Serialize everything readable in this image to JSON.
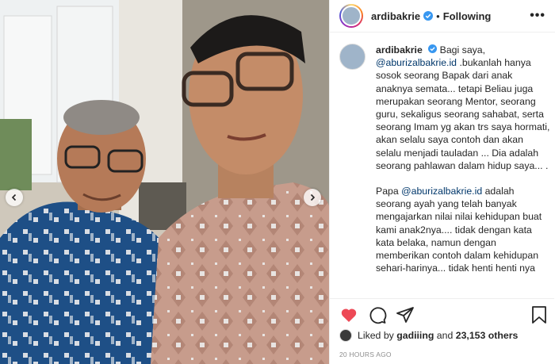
{
  "post": {
    "username": "ardibakrie",
    "follow_state": "Following",
    "separator": "•",
    "more_label": "•••"
  },
  "caption": {
    "username": "ardibakrie",
    "intro": "Bagi saya,",
    "mention1": "@aburizalbakrie.id",
    "text1": ".bukanlah hanya sosok seorang Bapak dari anak anaknya semata... tetapi Beliau juga merupakan seorang Mentor, seorang guru, sekaligus seorang sahabat, serta seorang Imam yg akan trs saya hormati, akan selalu saya contoh dan akan selalu menjadi tauladan ... Dia adalah seorang pahlawan dalam hidup saya... .",
    "papa": "Papa",
    "mention2": "@aburizalbakrie.id",
    "text2": "adalah seorang ayah yang telah banyak mengajarkan nilai nilai kehidupan buat kami anak2nya.... tidak dengan kata kata belaka, namun dengan memberikan contoh dalam kehidupan sehari-harinya... tidak henti henti nya"
  },
  "likes": {
    "liked_by": "Liked by",
    "user": "gadiiing",
    "and": "and",
    "count": "23,153 others"
  },
  "timestamp": "20 HOURS AGO",
  "icons": {
    "verified": "verified-badge-icon",
    "like": "heart-filled-icon",
    "comment": "comment-icon",
    "share": "paper-plane-icon",
    "save": "bookmark-icon",
    "prev": "chevron-left-icon",
    "next": "chevron-right-icon"
  },
  "colors": {
    "like_red": "#ed4956",
    "verified_blue": "#3897f0",
    "mention": "#00376b",
    "timestamp_gray": "#8e8e8e"
  }
}
